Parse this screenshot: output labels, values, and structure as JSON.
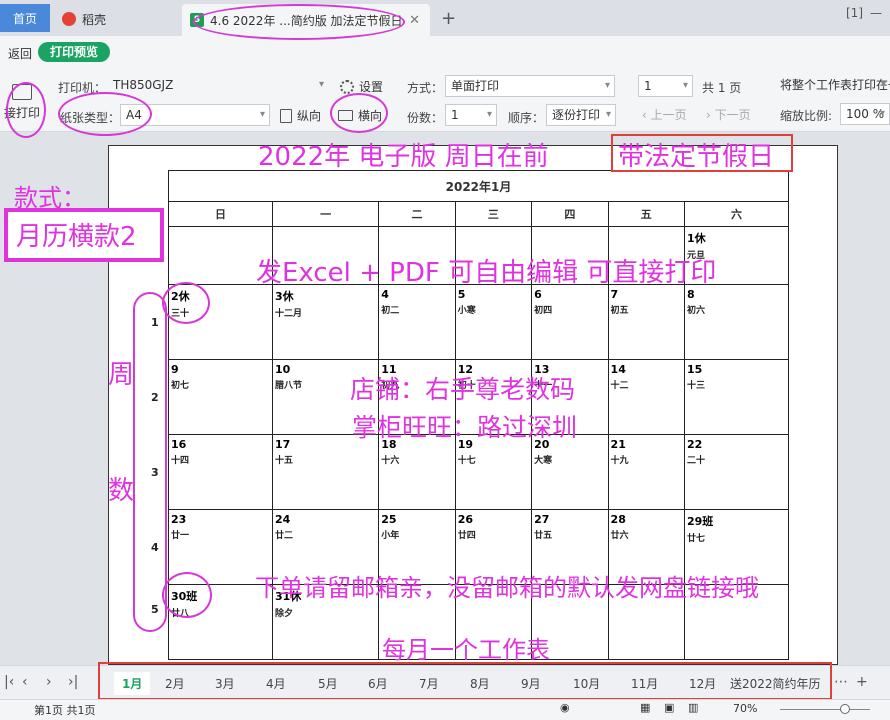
{
  "tabs": {
    "home": "首页",
    "daoke": "稻壳",
    "doc": "4.6 2022年 ...简约版 加法定节假日"
  },
  "toolbar": {
    "back": "返回",
    "preview": "打印预览",
    "direct_print": "接打印",
    "printer_label": "打印机：",
    "printer_value": "TH850GJZ",
    "settings": "设置",
    "paper_label": "纸张类型：",
    "paper_value": "A4",
    "portrait": "纵向",
    "landscape": "横向",
    "method_label": "方式：",
    "method_value": "单面打印",
    "copies_label": "份数：",
    "copies_value": "1",
    "order_label": "顺序：",
    "order_value": "逐份打印",
    "page_value": "1",
    "total_pages": "共 1 页",
    "prev_page": "上一页",
    "next_page": "下一页",
    "fit_value": "将整个工作表打印在一",
    "zoom_label": "缩放比例:",
    "zoom_value": "100 %"
  },
  "calendar": {
    "title": "2022年1月",
    "weekdays": [
      "日",
      "一",
      "二",
      "三",
      "四",
      "五",
      "六"
    ],
    "weeks": [
      [
        [
          "",
          ""
        ],
        [
          "",
          ""
        ],
        [
          "",
          ""
        ],
        [
          "",
          ""
        ],
        [
          "",
          ""
        ],
        [
          "",
          ""
        ],
        [
          "1休",
          "元旦"
        ]
      ],
      [
        [
          "2休",
          "三十"
        ],
        [
          "3休",
          "十二月"
        ],
        [
          "4",
          "初二"
        ],
        [
          "5",
          "小寒"
        ],
        [
          "6",
          "初四"
        ],
        [
          "7",
          "初五"
        ],
        [
          "8",
          "初六"
        ]
      ],
      [
        [
          "9",
          "初七"
        ],
        [
          "10",
          "腊八节"
        ],
        [
          "11",
          "初九"
        ],
        [
          "12",
          "初十"
        ],
        [
          "13",
          "十一"
        ],
        [
          "14",
          "十二"
        ],
        [
          "15",
          "十三"
        ]
      ],
      [
        [
          "16",
          "十四"
        ],
        [
          "17",
          "十五"
        ],
        [
          "18",
          "十六"
        ],
        [
          "19",
          "十七"
        ],
        [
          "20",
          "大寒"
        ],
        [
          "21",
          "十九"
        ],
        [
          "22",
          "二十"
        ]
      ],
      [
        [
          "23",
          "廿一"
        ],
        [
          "24",
          "廿二"
        ],
        [
          "25",
          "小年"
        ],
        [
          "26",
          "廿四"
        ],
        [
          "27",
          "廿五"
        ],
        [
          "28",
          "廿六"
        ],
        [
          "29班",
          "廿七"
        ]
      ],
      [
        [
          "30班",
          "廿八"
        ],
        [
          "31休",
          "除夕"
        ],
        [
          "",
          ""
        ],
        [
          "",
          ""
        ],
        [
          "",
          ""
        ],
        [
          "",
          ""
        ],
        [
          "",
          ""
        ]
      ]
    ],
    "week_numbers": [
      "1",
      "2",
      "3",
      "4",
      "5"
    ]
  },
  "annotations": {
    "headline": "2022年 电子版 周日在前",
    "holiday_box": "带法定节假日",
    "style_label": "款式：",
    "style_value": "月历横款2",
    "excel_pdf": "发Excel + PDF 可自由编辑 可直接打印",
    "shop": "店铺：右手尊老数码",
    "keeper": "掌柜旺旺：路过深圳",
    "week_col_1": "周",
    "week_col_2": "数",
    "order_note": "下单请留邮箱亲，没留邮箱的默认发网盘链接哦",
    "per_month": "每月一个工作表"
  },
  "sheets": [
    "1月",
    "2月",
    "3月",
    "4月",
    "5月",
    "6月",
    "7月",
    "8月",
    "9月",
    "10月",
    "11月",
    "12月",
    "送2022简约年历"
  ],
  "status": {
    "page_info": "第1页 共1页",
    "zoom": "70%"
  }
}
